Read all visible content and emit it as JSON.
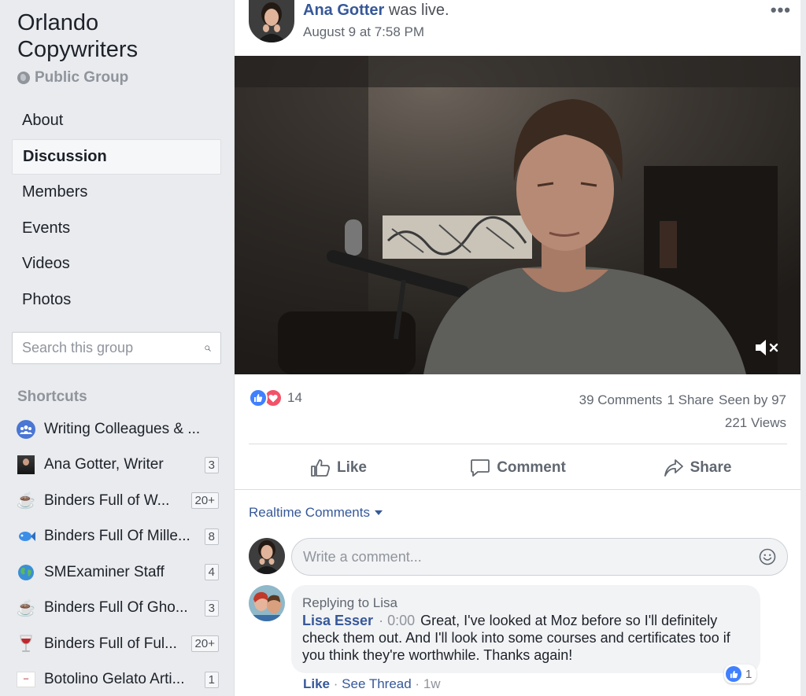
{
  "group": {
    "name": "Orlando Copywriters",
    "privacy": "Public Group"
  },
  "nav": {
    "items": [
      {
        "label": "About"
      },
      {
        "label": "Discussion",
        "active": true
      },
      {
        "label": "Members"
      },
      {
        "label": "Events"
      },
      {
        "label": "Videos"
      },
      {
        "label": "Photos"
      }
    ]
  },
  "search": {
    "placeholder": "Search this group"
  },
  "shortcuts": {
    "title": "Shortcuts",
    "items": [
      {
        "label": "Writing Colleagues & ...",
        "icon": "group-icon",
        "badge": ""
      },
      {
        "label": "Ana Gotter, Writer",
        "icon": "portrait-thumbnail",
        "badge": "3"
      },
      {
        "label": "Binders Full of W...",
        "icon": "coffee-icon",
        "badge": "20+"
      },
      {
        "label": "Binders Full Of Mille...",
        "icon": "fish-icon",
        "badge": "8"
      },
      {
        "label": "SMExaminer Staff",
        "icon": "globe-icon",
        "badge": "4"
      },
      {
        "label": "Binders Full Of Gho...",
        "icon": "coffee-icon",
        "badge": "3"
      },
      {
        "label": "Binders Full of Ful...",
        "icon": "wine-icon",
        "badge": "20+"
      },
      {
        "label": "Botolino Gelato Arti...",
        "icon": "gelato-logo",
        "badge": "1"
      }
    ]
  },
  "post": {
    "author": "Ana Gotter",
    "status_text": "was live.",
    "time": "August 9 at 7:58 PM",
    "more_label": "•••",
    "reaction_count": "14",
    "comments": "39 Comments",
    "shares": "1 Share",
    "seen_by": "Seen by 97",
    "views": "221 Views",
    "actions": {
      "like": "Like",
      "comment": "Comment",
      "share": "Share"
    }
  },
  "comments": {
    "filter_label": "Realtime Comments",
    "input_placeholder": "Write a comment...",
    "items": [
      {
        "replying_to": "Replying to Lisa",
        "author": "Lisa Esser",
        "timestamp": "0:00",
        "text": "Great, I've looked at Moz before so I'll definitely check them out. And I'll look into some courses and certificates too if you think they're worthwhile. Thanks again!",
        "reaction_count": "1",
        "like_label": "Like",
        "thread_label": "See Thread",
        "age": "1w"
      }
    ]
  },
  "colors": {
    "link_blue": "#365899",
    "like_blue": "#4080ff",
    "love_red": "#f25268",
    "sidebar_bg": "#e9ebee"
  }
}
